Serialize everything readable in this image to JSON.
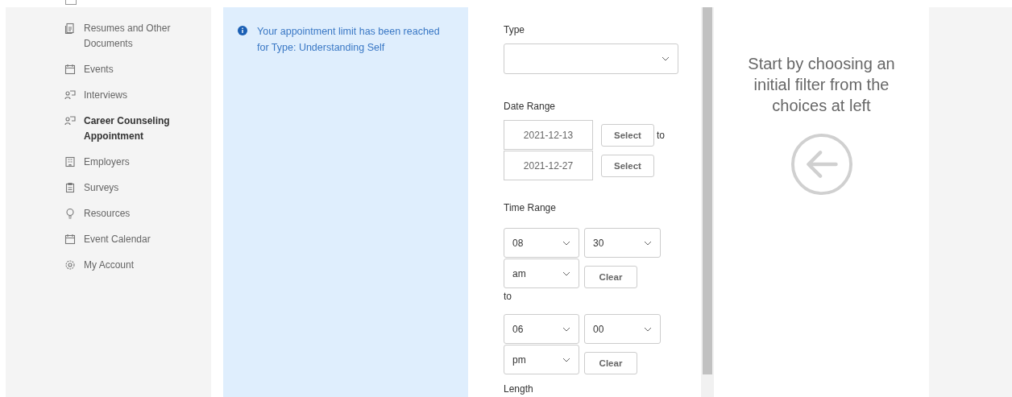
{
  "sidebar": {
    "items": [
      {
        "label": "Resumes and Other Documents",
        "selected": false
      },
      {
        "label": "Events",
        "selected": false
      },
      {
        "label": "Interviews",
        "selected": false
      },
      {
        "label": "Career Counseling Appointment",
        "selected": true
      },
      {
        "label": "Employers",
        "selected": false
      },
      {
        "label": "Surveys",
        "selected": false
      },
      {
        "label": "Resources",
        "selected": false
      },
      {
        "label": "Event Calendar",
        "selected": false
      },
      {
        "label": "My Account",
        "selected": false
      }
    ]
  },
  "alert": {
    "message": "Your appointment limit has been reached for Type: Understanding Self"
  },
  "form": {
    "type": {
      "label": "Type"
    },
    "date_range": {
      "label": "Date Range",
      "from": "2021-12-13",
      "to": "2021-12-27",
      "button": "Select",
      "button_2": "Select",
      "separator": "to"
    },
    "time_range": {
      "label": "Time Range",
      "start": {
        "hour": "08",
        "minute": "30",
        "ampm": "am",
        "clear": "Clear"
      },
      "separator": "to",
      "end": {
        "hour": "06",
        "minute": "00",
        "ampm": "pm",
        "clear": "Clear"
      }
    },
    "length": {
      "label": "Length"
    }
  },
  "results": {
    "message": "Start by choosing an initial filter from the choices at left"
  }
}
